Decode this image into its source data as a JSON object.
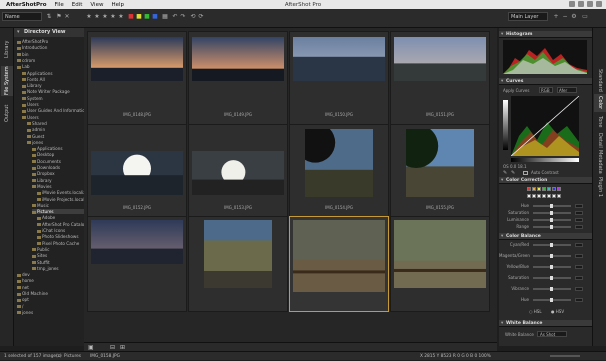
{
  "menubar": {
    "app_name": "AfterShotPro",
    "menus": [
      "File",
      "Edit",
      "View",
      "Help"
    ],
    "window_title": "AfterShot Pro"
  },
  "toolbar": {
    "view_select": "Name",
    "layer_select": "Main Layer"
  },
  "left_tabs": [
    "Library",
    "File System",
    "Output"
  ],
  "right_tabs": [
    "Standard",
    "Color",
    "Tone",
    "Detail",
    "Metadata",
    "Plugin 1"
  ],
  "directory": {
    "title": "Directory View",
    "items": [
      {
        "label": "AfterShotPro",
        "depth": 0
      },
      {
        "label": "Introduction",
        "depth": 0
      },
      {
        "label": "bin",
        "depth": 0
      },
      {
        "label": "cdrom",
        "depth": 0
      },
      {
        "label": "Lab",
        "depth": 0
      },
      {
        "label": "Applications",
        "depth": 1
      },
      {
        "label": "Fonts All",
        "depth": 1
      },
      {
        "label": "Library",
        "depth": 1
      },
      {
        "label": "Note Writer Package",
        "depth": 1
      },
      {
        "label": "System",
        "depth": 1
      },
      {
        "label": "Users",
        "depth": 1
      },
      {
        "label": "User Guides And Information",
        "depth": 1
      },
      {
        "label": "Users",
        "depth": 1
      },
      {
        "label": "Shared",
        "depth": 2
      },
      {
        "label": "admin",
        "depth": 2
      },
      {
        "label": "Guest",
        "depth": 2
      },
      {
        "label": "jones",
        "depth": 2
      },
      {
        "label": "Applications",
        "depth": 3
      },
      {
        "label": "Desktop",
        "depth": 3
      },
      {
        "label": "Documents",
        "depth": 3
      },
      {
        "label": "Downloads",
        "depth": 3
      },
      {
        "label": "Dropbox",
        "depth": 3
      },
      {
        "label": "Library",
        "depth": 3
      },
      {
        "label": "Movies",
        "depth": 3
      },
      {
        "label": "iMovie Events.localiz",
        "depth": 4
      },
      {
        "label": "iMovie Projects.locali",
        "depth": 4
      },
      {
        "label": "Music",
        "depth": 3
      },
      {
        "label": "Pictures",
        "depth": 3,
        "selected": true
      },
      {
        "label": "Adobe",
        "depth": 4
      },
      {
        "label": "AfterShot Pro Catalo",
        "depth": 4
      },
      {
        "label": "iChat Icons",
        "depth": 4
      },
      {
        "label": "Photo Slideshows",
        "depth": 4
      },
      {
        "label": "Pixel Photo Cache",
        "depth": 4
      },
      {
        "label": "Public",
        "depth": 3
      },
      {
        "label": "Sites",
        "depth": 3
      },
      {
        "label": "Stuffit",
        "depth": 3
      },
      {
        "label": "tmp_jones",
        "depth": 3
      },
      {
        "label": "dev",
        "depth": 0
      },
      {
        "label": "home",
        "depth": 0
      },
      {
        "label": "net",
        "depth": 0
      },
      {
        "label": "Old Machine",
        "depth": 0
      },
      {
        "label": "opt",
        "depth": 0
      },
      {
        "label": "/",
        "depth": 0
      },
      {
        "label": "jones",
        "depth": 0
      }
    ]
  },
  "thumbnails": [
    {
      "caption": "IMG_0148.JPG",
      "kind": "sunset"
    },
    {
      "caption": "IMG_0149.JPG",
      "kind": "sunset2"
    },
    {
      "caption": "IMG_0150.JPG",
      "kind": "sea"
    },
    {
      "caption": "IMG_0151.JPG",
      "kind": "shore"
    },
    {
      "caption": "IMG_0152.JPG",
      "kind": "sun"
    },
    {
      "caption": "IMG_0153.JPG",
      "kind": "sun2"
    },
    {
      "caption": "IMG_0154.JPG",
      "kind": "tree"
    },
    {
      "caption": "IMG_0155.JPG",
      "kind": "tree2"
    },
    {
      "caption": "",
      "kind": "dusk"
    },
    {
      "caption": "",
      "kind": "rocks"
    },
    {
      "caption": "",
      "kind": "track",
      "selected": true
    },
    {
      "caption": "",
      "kind": "track2"
    }
  ],
  "panels": {
    "histogram": {
      "title": "Histogram"
    },
    "curves": {
      "title": "Curves",
      "apply_label": "Apply Curves",
      "channel": "RGB",
      "mode": "Afer",
      "auto_label": "Auto Contrast",
      "readout": "OS  0.0  18.1"
    },
    "color_correction": {
      "title": "Color Correction",
      "sliders": [
        "Hue",
        "Saturation",
        "Luminance",
        "Range"
      ]
    },
    "color_balance": {
      "title": "Color Balance",
      "sliders": [
        "Cyan/Red",
        "Magenta/Green",
        "Yellow/Blue",
        "Saturation",
        "Vibrance",
        "Hue"
      ],
      "mode_a": "HSL",
      "mode_b": "HSV"
    },
    "white_balance": {
      "title": "White Balance",
      "label": "White Balance",
      "value": "As Shot"
    }
  },
  "status": {
    "left": "1 selected of 157 image(s)",
    "path": "Pictures",
    "file": "IMG_0158.JPG",
    "right": "X 2815  Y 8523  R 0  G 0  B 0  100%"
  }
}
